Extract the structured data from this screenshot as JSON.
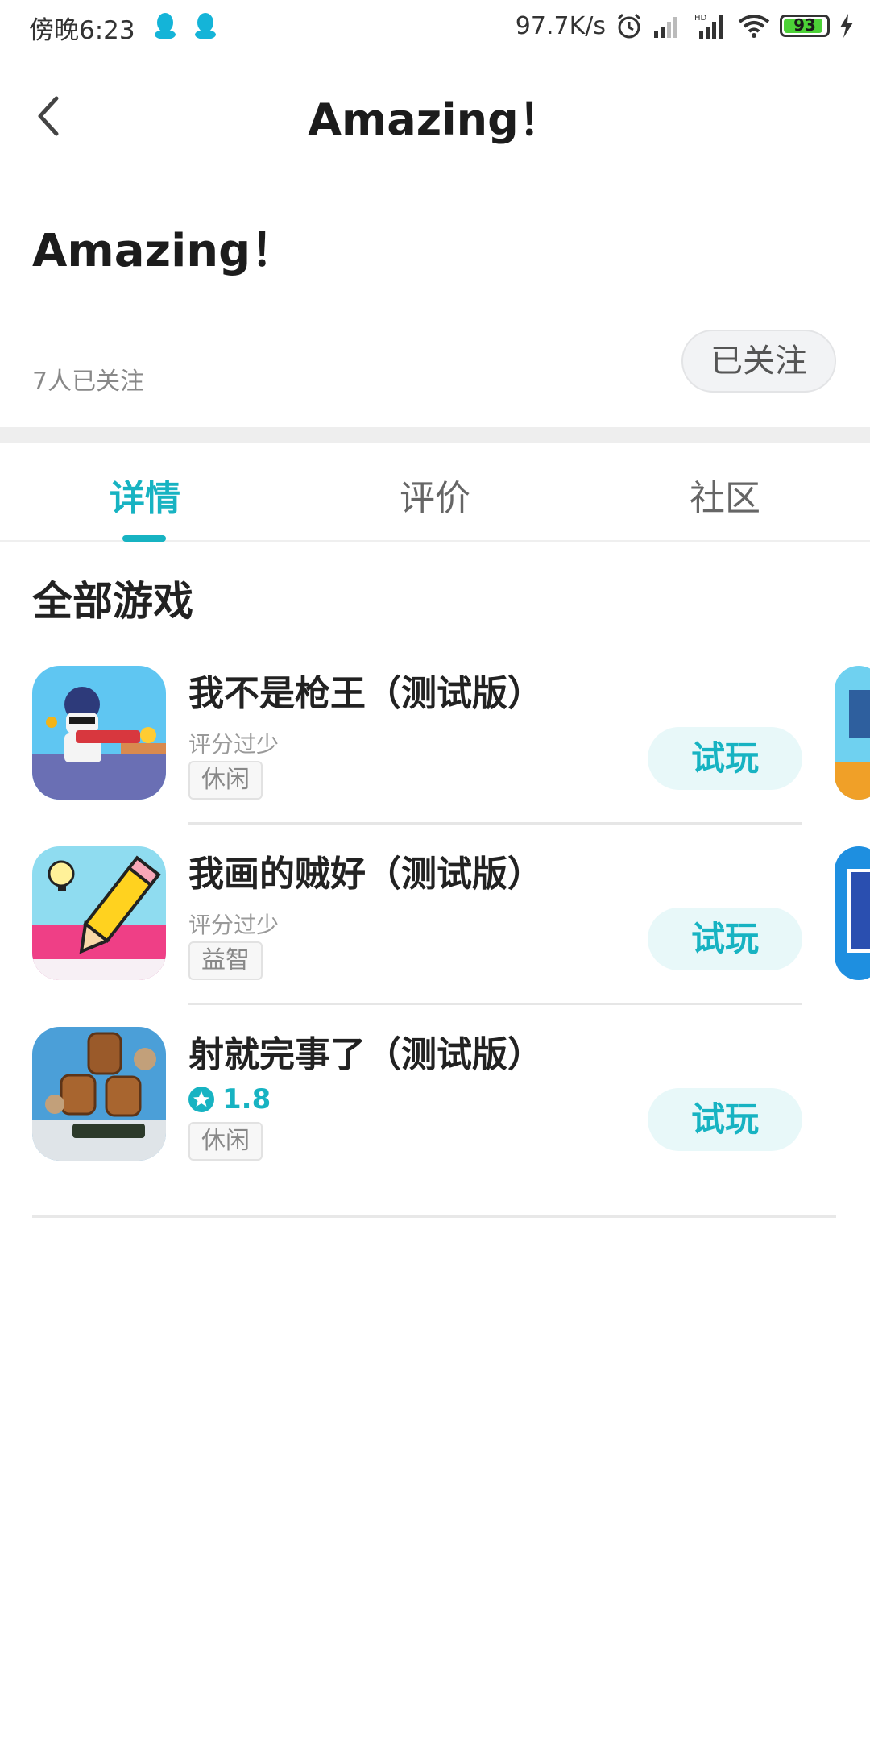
{
  "status_bar": {
    "time": "傍晚6:23",
    "net_speed": "97.7K/s",
    "battery": "93",
    "battery_level": 0.93
  },
  "nav": {
    "title": "Amazing！"
  },
  "header": {
    "title": "Amazing！",
    "followers": "7人已关注",
    "follow_button": "已关注"
  },
  "tabs": [
    {
      "label": "详情",
      "active": true
    },
    {
      "label": "评价",
      "active": false
    },
    {
      "label": "社区",
      "active": false
    }
  ],
  "section": {
    "title": "全部游戏"
  },
  "games": [
    {
      "name": "我不是枪王（测试版）",
      "rating_text": "评分过少",
      "tag": "休闲",
      "button": "试玩"
    },
    {
      "name": "我画的贼好（测试版）",
      "rating_text": "评分过少",
      "tag": "益智",
      "button": "试玩"
    },
    {
      "name": "射就完事了（测试版）",
      "rating": "1.8",
      "tag": "休闲",
      "button": "试玩"
    }
  ],
  "colors": {
    "accent": "#17b3c2",
    "battery": "#4cd137"
  }
}
